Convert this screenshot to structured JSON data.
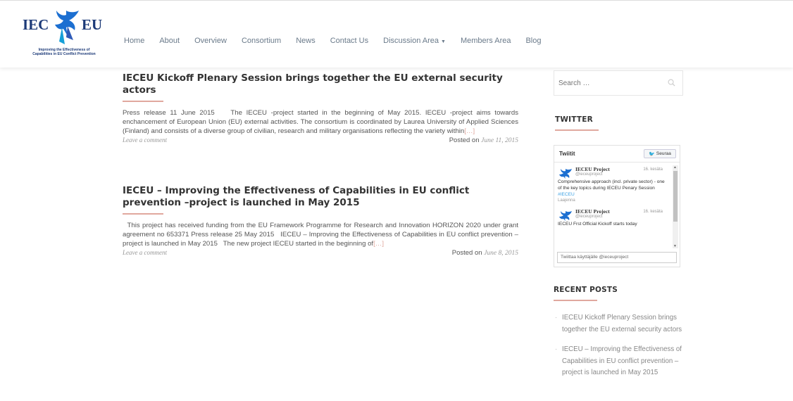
{
  "logo": {
    "left_text": "IEC",
    "right_text": "EU",
    "tagline_1": "Improving the Effectiveness of",
    "tagline_2": "Capabilities in EU Conflict Prevention"
  },
  "nav": [
    {
      "label": "Home"
    },
    {
      "label": "About"
    },
    {
      "label": "Overview"
    },
    {
      "label": "Consortium"
    },
    {
      "label": "News"
    },
    {
      "label": "Contact Us"
    },
    {
      "label": "Discussion Area"
    },
    {
      "label": "Members Area"
    },
    {
      "label": "Blog"
    }
  ],
  "posts": [
    {
      "title": "IECEU Kickoff Plenary Session brings together the EU external security actors",
      "excerpt": "Press release 11 June 2015    The IECEU -project started in the beginning of May 2015. IECEU -project aims towards enchancement of European Union (EU) external activities. The consortium is coordinated by Laurea University of Applied Sciences (Finland) and consists of a diverse group of civilian, research and military organisations reflecting the variety within",
      "more": "[…]",
      "comment": "Leave a comment",
      "posted_label": "Posted on ",
      "date": "June 11, 2015"
    },
    {
      "title": "IECEU – Improving the Effectiveness of Capabilities in EU conflict prevention –project is launched in May 2015",
      "excerpt": "  This project has received funding from the EU Framework Programme for Research and Innovation HORIZON 2020 under grant agreement no 653371 Press release 25 May 2015   IECEU – Improving the Effectiveness of Capabilities in EU conflict prevention –project is launched in May 2015   The new project IECEU started in the beginning of",
      "more": "[…]",
      "comment": "Leave a comment",
      "posted_label": "Posted on ",
      "date": "June 8, 2015"
    }
  ],
  "sidebar": {
    "search_placeholder": "Search …",
    "twitter_title": "TWITTER",
    "twitter": {
      "header": "Twiitit",
      "follow": "Seuraa",
      "tweets": [
        {
          "name": "IECEU Project",
          "handle": "@ieceuproject",
          "time": "16. kesäta",
          "text": "Comprehensive approach (incl. private sector) - one of the key topics during IECEU Penary Session ",
          "hashtag": "#IECEU",
          "expand": "Laajenna"
        },
        {
          "name": "IECEU Project",
          "handle": "@ieceuproject",
          "time": "16. kesäta",
          "text": "IECEU Frst Official Kickoff starts today",
          "hashtag": "",
          "expand": ""
        }
      ],
      "reply_placeholder": "Twiittaa käyttäjälle @ieceuproject"
    },
    "recent_title": "RECENT POSTS",
    "recent_posts": [
      "IECEU Kickoff Plenary Session brings together the EU external security actors",
      "IECEU – Improving the Effectiveness of Capabilities in EU conflict prevention –project is launched in May 2015"
    ]
  },
  "colors": {
    "accent_rule": "#e0a89e",
    "logo_blue": "#1c3a78",
    "twitter_blue": "#3aa1e4"
  }
}
